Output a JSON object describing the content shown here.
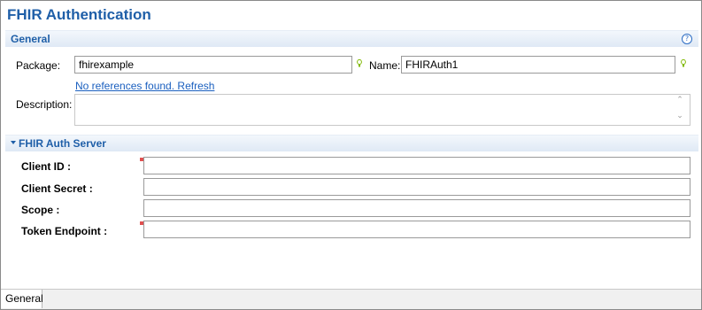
{
  "editor": {
    "title": "FHIR Authentication"
  },
  "general": {
    "section_title": "General",
    "help_icon": "?",
    "package_label": "Package:",
    "package_value": "fhirexample",
    "name_label": "Name:",
    "name_value": "FHIRAuth1",
    "references_link": "No references found. Refresh",
    "description_label": "Description:",
    "description_value": ""
  },
  "auth_server": {
    "section_title": "FHIR Auth Server",
    "fields": [
      {
        "label": "Client ID :",
        "value": "",
        "required": true
      },
      {
        "label": "Client Secret :",
        "value": "",
        "required": false
      },
      {
        "label": "Scope :",
        "value": "",
        "required": false
      },
      {
        "label": "Token Endpoint :",
        "value": "",
        "required": true
      }
    ]
  },
  "bottom_tabs": {
    "general_label": "General"
  },
  "colors": {
    "title": "#1f5fa8",
    "link": "#1a5fbf",
    "required_marker": "#e05050",
    "lightbulb": "#7fb800"
  }
}
